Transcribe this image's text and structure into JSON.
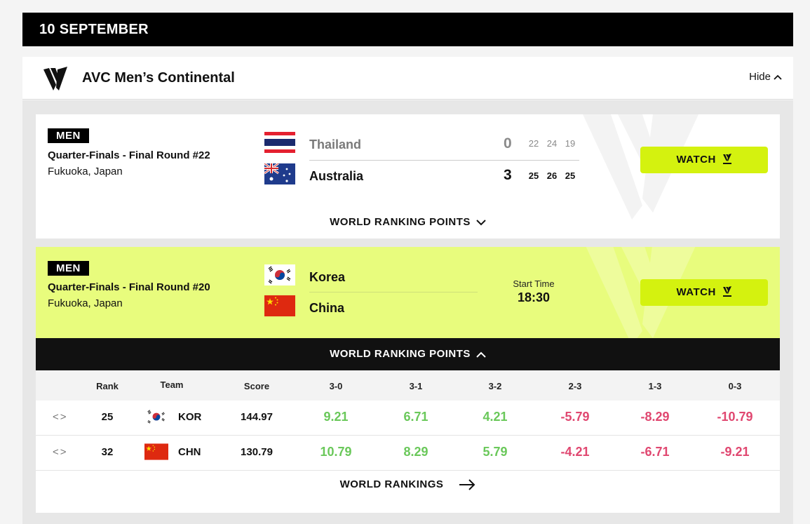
{
  "date_header": "10 SEPTEMBER",
  "competition": {
    "title": "AVC Men’s Continental",
    "hide_label": "Hide"
  },
  "matches": [
    {
      "gender": "MEN",
      "round": "Quarter-Finals - Final Round #22",
      "venue": "Fukuoka, Japan",
      "team1": {
        "name": "Thailand",
        "score": "0",
        "sets": [
          "22",
          "24",
          "19"
        ]
      },
      "team2": {
        "name": "Australia",
        "score": "3",
        "sets": [
          "25",
          "26",
          "25"
        ]
      },
      "watch_label": "WATCH",
      "wrp_label": "WORLD RANKING POINTS"
    },
    {
      "gender": "MEN",
      "round": "Quarter-Finals - Final Round #20",
      "venue": "Fukuoka, Japan",
      "team1": {
        "name": "Korea"
      },
      "team2": {
        "name": "China"
      },
      "start_time_label": "Start Time",
      "start_time": "18:30",
      "watch_label": "WATCH",
      "wrp_label": "WORLD RANKING POINTS"
    }
  ],
  "ranking_table": {
    "headers": [
      "Rank",
      "Team",
      "Score",
      "3-0",
      "3-1",
      "3-2",
      "2-3",
      "1-3",
      "0-3"
    ],
    "rows": [
      {
        "rank": "25",
        "team": "KOR",
        "score": "144.97",
        "values": [
          "9.21",
          "6.71",
          "4.21",
          "-5.79",
          "-8.29",
          "-10.79"
        ]
      },
      {
        "rank": "32",
        "team": "CHN",
        "score": "130.79",
        "values": [
          "10.79",
          "8.29",
          "5.79",
          "-4.21",
          "-6.71",
          "-9.21"
        ]
      }
    ],
    "world_rankings_label": "WORLD RANKINGS"
  },
  "colors": {
    "accent": "#d4f20f",
    "highlight": "#e8fc7d",
    "positive": "#6ac85a",
    "negative": "#e04770"
  }
}
